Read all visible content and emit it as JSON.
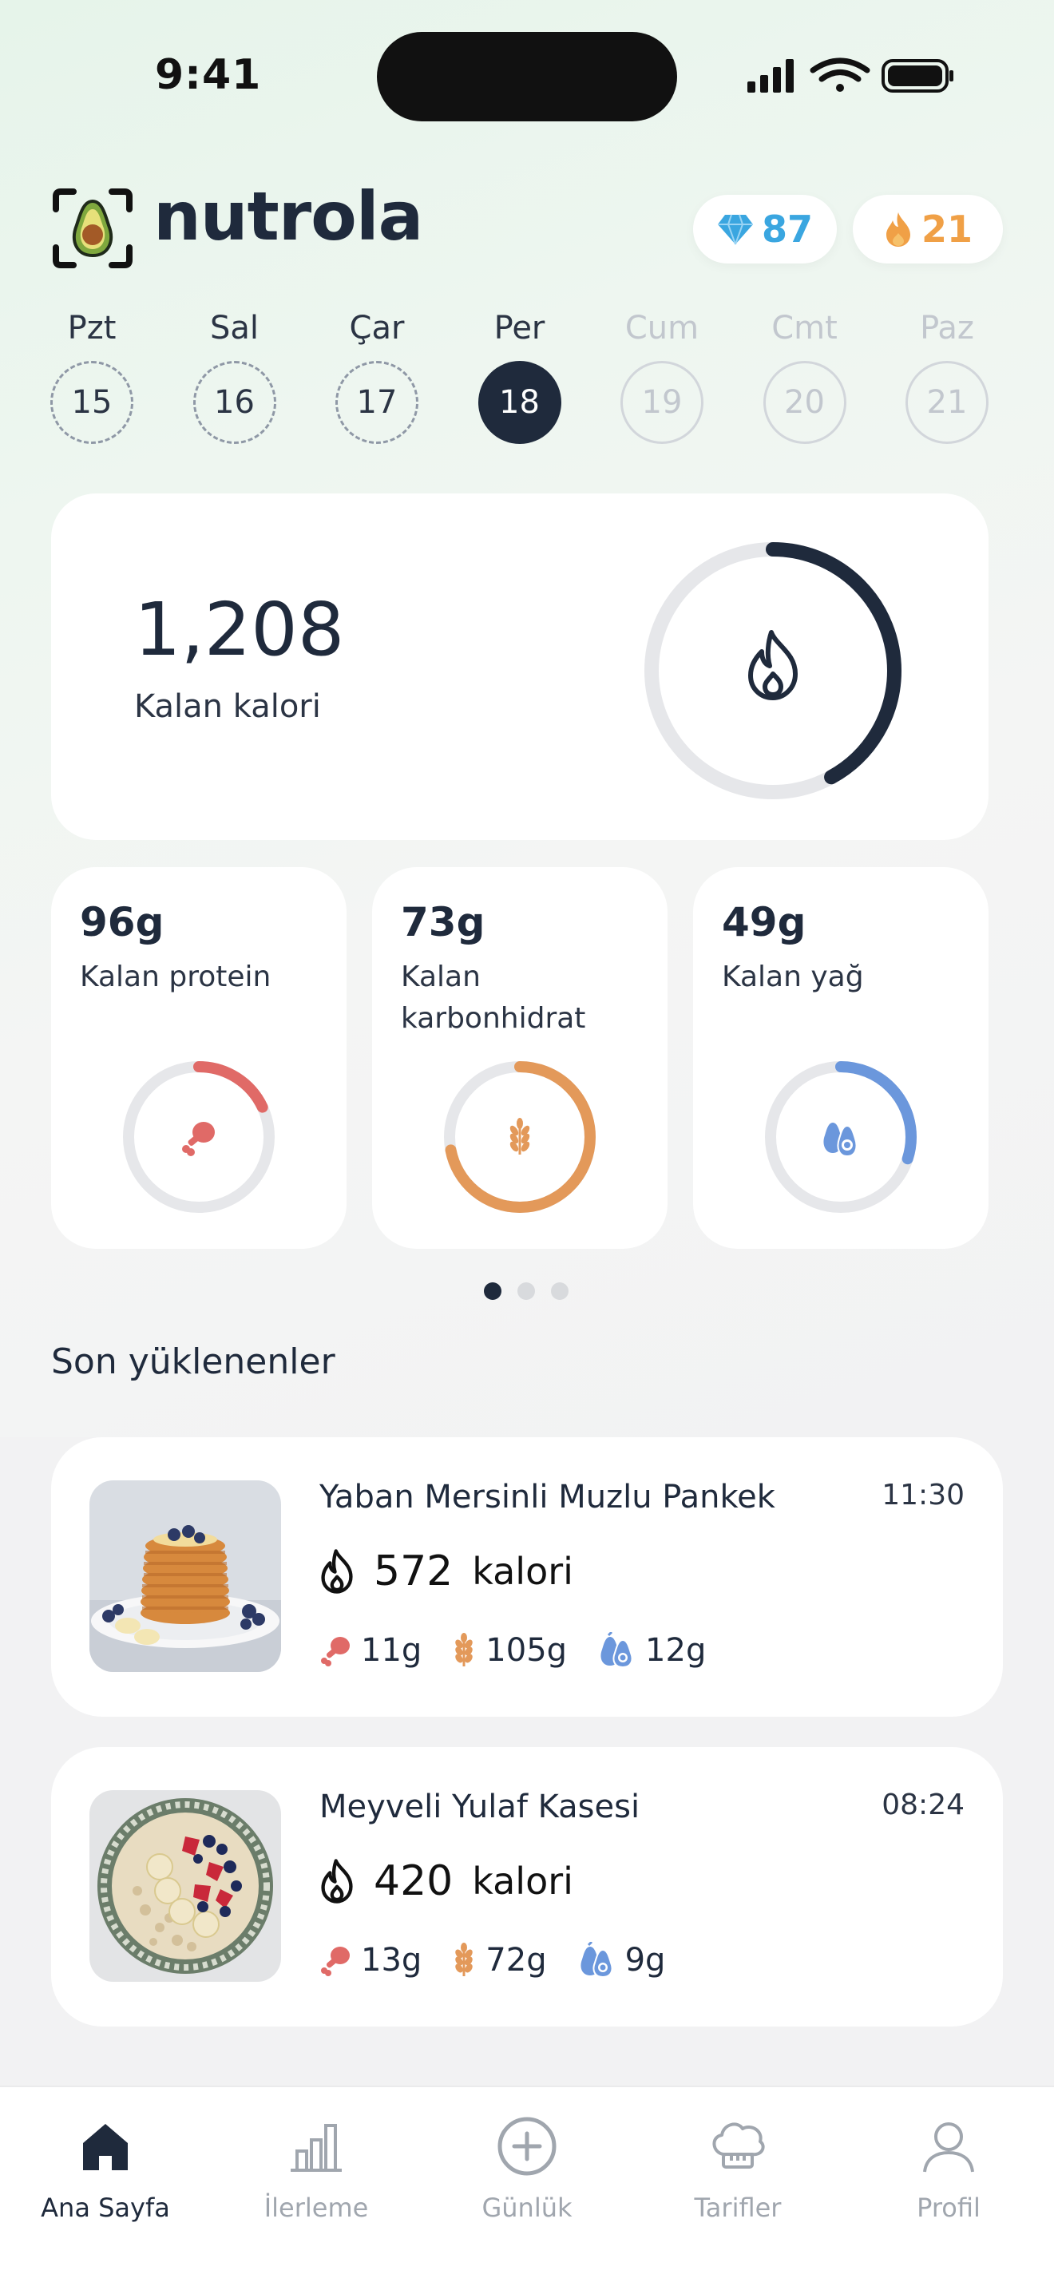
{
  "status_bar": {
    "time": "9:41"
  },
  "header": {
    "brand": "nutrola",
    "gems": "87",
    "streak": "21"
  },
  "week": [
    {
      "day": "Pzt",
      "date": "15",
      "state": "past"
    },
    {
      "day": "Sal",
      "date": "16",
      "state": "past"
    },
    {
      "day": "Çar",
      "date": "17",
      "state": "past"
    },
    {
      "day": "Per",
      "date": "18",
      "state": "today"
    },
    {
      "day": "Cum",
      "date": "19",
      "state": "future"
    },
    {
      "day": "Cmt",
      "date": "20",
      "state": "future"
    },
    {
      "day": "Paz",
      "date": "21",
      "state": "future"
    }
  ],
  "calories": {
    "value": "1,208",
    "label": "Kalan kalori",
    "progress": 0.42,
    "color": "#1f2a3c"
  },
  "macros": [
    {
      "value": "96g",
      "label": "Kalan protein",
      "progress": 0.18,
      "color": "#e06a67",
      "icon": "drumstick-icon"
    },
    {
      "value": "73g",
      "label": "Kalan karbonhidrat",
      "progress": 0.72,
      "color": "#e3995a",
      "icon": "wheat-icon"
    },
    {
      "value": "49g",
      "label": "Kalan yağ",
      "progress": 0.3,
      "color": "#6b97dc",
      "icon": "avocado-icon"
    }
  ],
  "section": {
    "title": "Son yüklenenler"
  },
  "meals": [
    {
      "name": "Yaban Mersinli Muzlu Pankek",
      "time": "11:30",
      "kcal": "572",
      "kcal_unit": "kalori",
      "protein": "11g",
      "carbs": "105g",
      "fat": "12g"
    },
    {
      "name": "Meyveli Yulaf Kasesi",
      "time": "08:24",
      "kcal": "420",
      "kcal_unit": "kalori",
      "protein": "13g",
      "carbs": "72g",
      "fat": "9g"
    }
  ],
  "nav": [
    {
      "label": "Ana Sayfa",
      "icon": "home-icon",
      "active": true
    },
    {
      "label": "İlerleme",
      "icon": "bar-chart-icon",
      "active": false
    },
    {
      "label": "Günlük",
      "icon": "plus-circle-icon",
      "active": false
    },
    {
      "label": "Tarifler",
      "icon": "chef-hat-icon",
      "active": false
    },
    {
      "label": "Profil",
      "icon": "profile-icon",
      "active": false
    }
  ],
  "colors": {
    "protein": "#e06a67",
    "carbs": "#e3995a",
    "fat": "#6b97dc",
    "dark": "#1f2a3c"
  }
}
